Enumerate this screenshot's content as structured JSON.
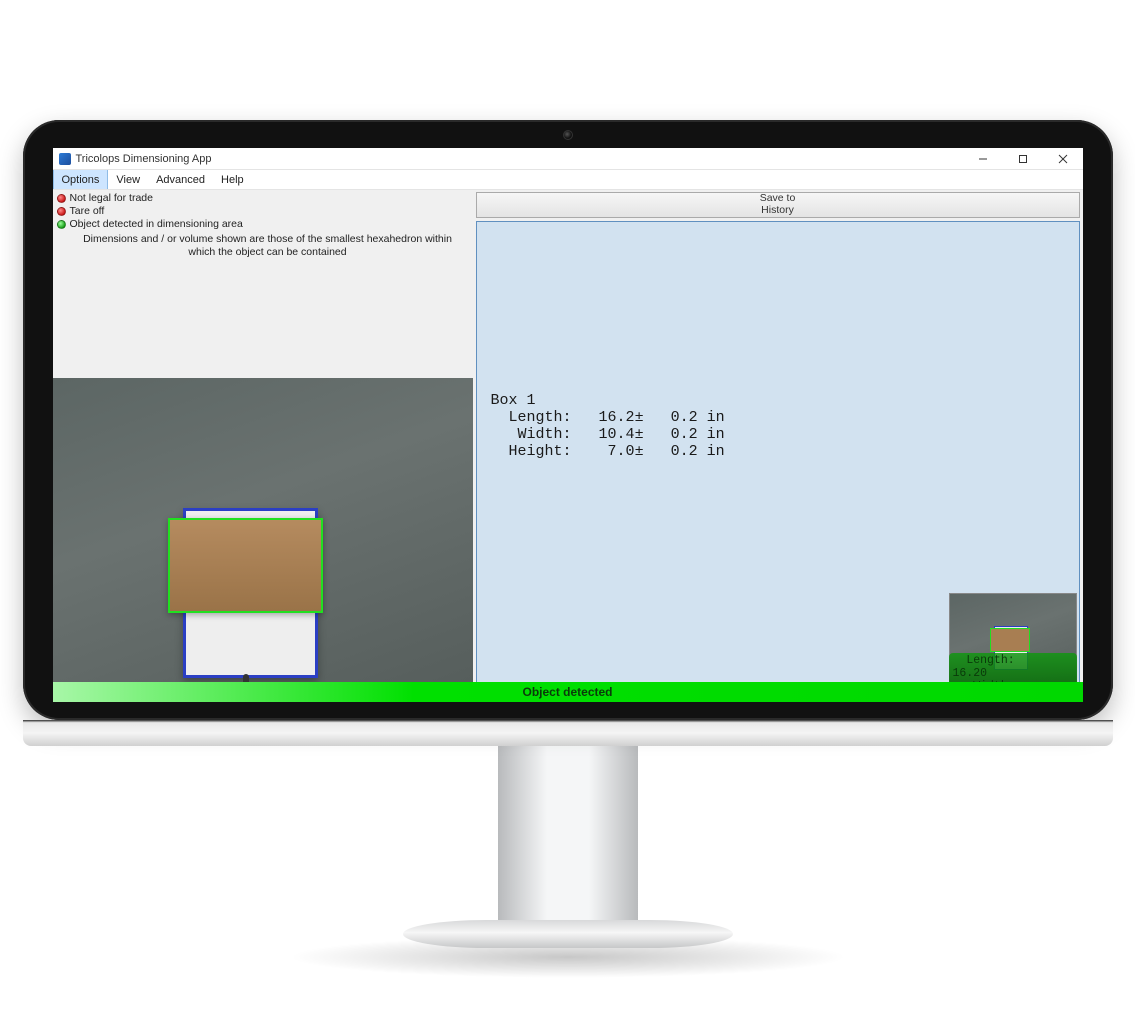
{
  "window": {
    "title": "Tricolops Dimensioning App"
  },
  "menu": {
    "items": [
      "Options",
      "View",
      "Advanced",
      "Help"
    ],
    "active_index": 0
  },
  "status": {
    "line1": {
      "dot": "red",
      "text": "Not legal for trade"
    },
    "line2": {
      "dot": "red",
      "text": "Tare off"
    },
    "line3": {
      "dot": "green",
      "text": "Object detected in dimensioning area"
    },
    "description": "Dimensions and / or volume shown are those of the smallest hexahedron within which the object can be contained"
  },
  "save_button": {
    "line1": "Save to",
    "line2": "History"
  },
  "results": {
    "title": "Box 1",
    "rows": [
      {
        "label": "Length:",
        "value": "16.2",
        "tol": "0.2",
        "unit": "in"
      },
      {
        "label": "Width:",
        "value": "10.4",
        "tol": "0.2",
        "unit": "in"
      },
      {
        "label": "Height:",
        "value": "7.0",
        "tol": "0.2",
        "unit": "in"
      }
    ]
  },
  "mini_overlay": {
    "l_label": "Length:",
    "l_value": "16.20",
    "w_label": "Width:"
  },
  "bottom_status": "Object detected"
}
